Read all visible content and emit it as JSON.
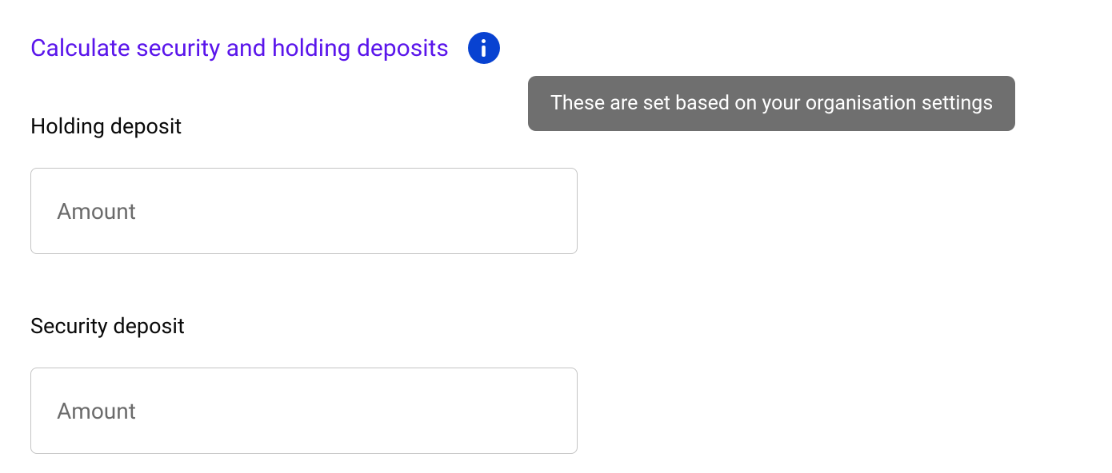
{
  "header": {
    "title": "Calculate security and holding deposits",
    "info_icon": "info-icon",
    "tooltip_text": "These are set based on your organisation settings"
  },
  "fields": {
    "holding_deposit": {
      "label": "Holding deposit",
      "placeholder": "Amount",
      "value": ""
    },
    "security_deposit": {
      "label": "Security deposit",
      "placeholder": "Amount",
      "value": ""
    }
  }
}
